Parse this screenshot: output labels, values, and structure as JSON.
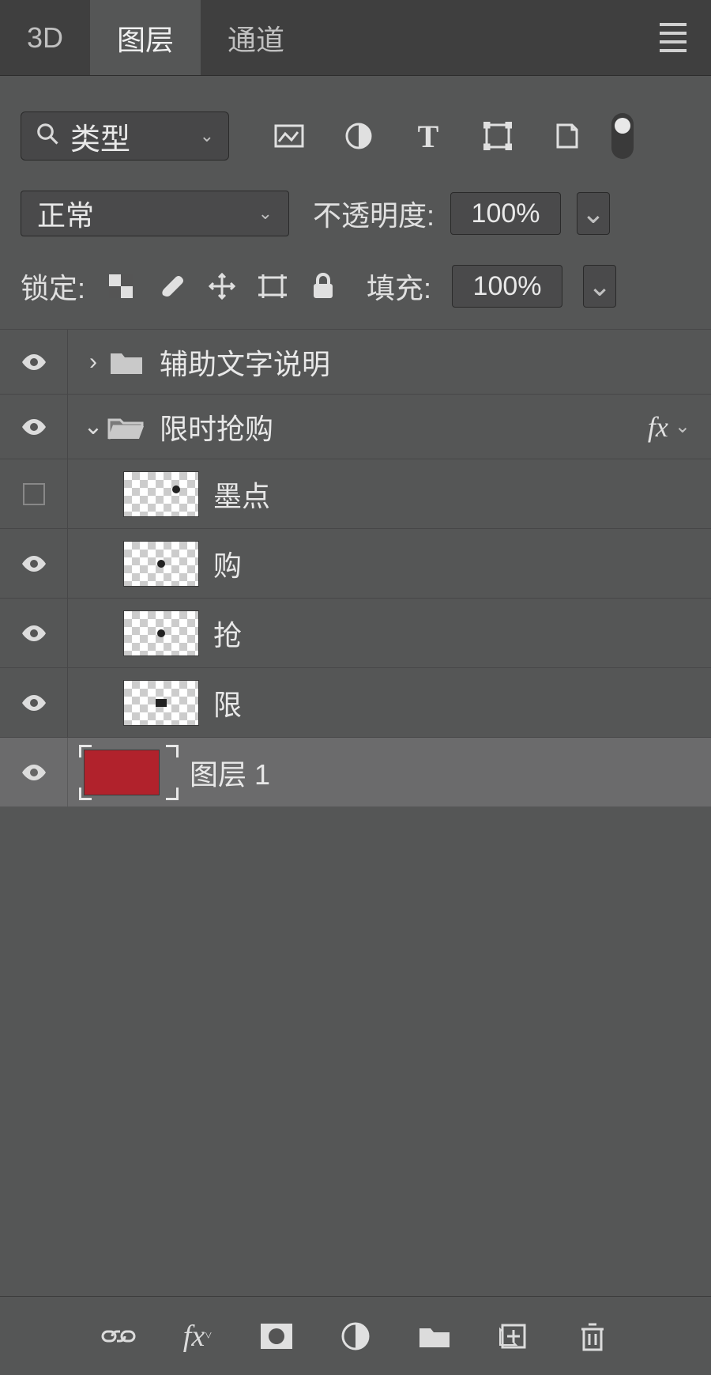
{
  "tabs": {
    "tab_3d": "3D",
    "tab_layers": "图层",
    "tab_channels": "通道"
  },
  "filter": {
    "kind_label": "类型"
  },
  "blend": {
    "mode": "正常",
    "opacity_label": "不透明度:",
    "opacity_value": "100%"
  },
  "lock": {
    "label": "锁定:",
    "fill_label": "填充:",
    "fill_value": "100%"
  },
  "layers": [
    {
      "name": "辅助文字说明",
      "type": "group",
      "expanded": false,
      "visible": true
    },
    {
      "name": "限时抢购",
      "type": "group",
      "expanded": true,
      "visible": true,
      "fx": true
    },
    {
      "name": "墨点",
      "type": "layer",
      "indent": 2,
      "visible": false
    },
    {
      "name": "购",
      "type": "layer",
      "indent": 2,
      "visible": true
    },
    {
      "name": "抢",
      "type": "layer",
      "indent": 2,
      "visible": true
    },
    {
      "name": "限",
      "type": "layer",
      "indent": 2,
      "visible": true
    },
    {
      "name": "图层 1",
      "type": "layer",
      "indent": 1,
      "visible": true,
      "selected": true,
      "red": true
    }
  ],
  "fx_label": "fx"
}
